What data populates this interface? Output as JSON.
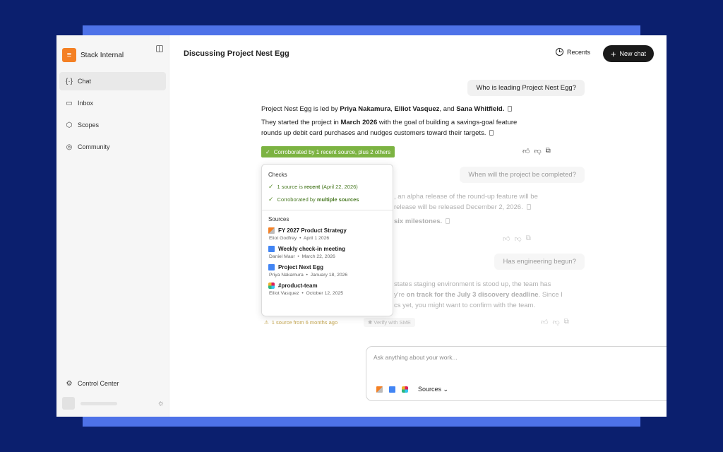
{
  "app": {
    "name": "Stack Internal"
  },
  "sidebar": {
    "items": [
      {
        "label": "Chat",
        "icon": "chat-braces-icon"
      },
      {
        "label": "Inbox",
        "icon": "inbox-icon"
      },
      {
        "label": "Scopes",
        "icon": "cube-icon"
      },
      {
        "label": "Community",
        "icon": "community-icon"
      }
    ],
    "control_center": "Control Center"
  },
  "header": {
    "title": "Discussing Project Nest Egg",
    "recents": "Recents",
    "new_chat": "New chat"
  },
  "conversation": {
    "q1": "Who is leading Project Nest Egg?",
    "a1_p1_prefix": "Project Nest Egg is led by ",
    "a1_p1_name1": "Priya Nakamura",
    "a1_p1_sep1": ", ",
    "a1_p1_name2": "Elliot Vasquez",
    "a1_p1_sep2": ", and ",
    "a1_p1_name3": "Sana Whitfield.",
    "a1_p2_prefix": "They started the project in ",
    "a1_p2_date": "March 2026",
    "a1_p2_line1_suffix": " with the goal of building a savings-goal feature",
    "a1_p2_line2": "rounds up debit card purchases and nudges customers toward their targets.",
    "badge": "Corroborated by 1 recent source, plus 2 others",
    "q2": "When will the project be completed?",
    "a2_line1": ", an alpha release of the round-up feature will be",
    "a2_line2": "release will be released December 2, 2026.",
    "a2_line3": "six milestones.",
    "q3": "Has engineering begun?",
    "a3_line1": "states staging environment is stood up, the team has",
    "a3_line2_prefix": "y're ",
    "a3_line2_bold": "on track for the July 3 discovery deadline",
    "a3_line2_suffix": ". Since I",
    "a3_line3": "cs yet, you might want to confirm with the team.",
    "warning": "1 source from 6 months ago",
    "verify_sme": "Verify with SME"
  },
  "popover": {
    "checks_title": "Checks",
    "check1_prefix": "1 source is ",
    "check1_bold": "recent",
    "check1_suffix": " (April 22, 2026)",
    "check2_prefix": "Corroborated by ",
    "check2_bold": "multiple sources",
    "sources_title": "Sources",
    "sources": [
      {
        "title": "FY 2027 Product Strategy",
        "author": "Eliot Godfrey",
        "date": "April 1 2026",
        "icon": "stack-overflow-icon"
      },
      {
        "title": "Weekly check-in meeting",
        "author": "Daniel Maur",
        "date": "March 22, 2026",
        "icon": "google-doc-icon"
      },
      {
        "title": "Project Next Egg",
        "author": "Priya Nakamura",
        "date": "January 18, 2026",
        "icon": "google-doc-icon"
      },
      {
        "title": "#product-team",
        "author": "Elliot Vasquez",
        "date": "October 12, 2025",
        "icon": "slack-icon"
      }
    ]
  },
  "composer": {
    "placeholder": "Ask anything about your work...",
    "sources": "Sources"
  },
  "colors": {
    "background": "#0b1f6e",
    "band": "#4e72e8",
    "badge_green": "#7cb342",
    "brand_orange": "#f48024"
  }
}
